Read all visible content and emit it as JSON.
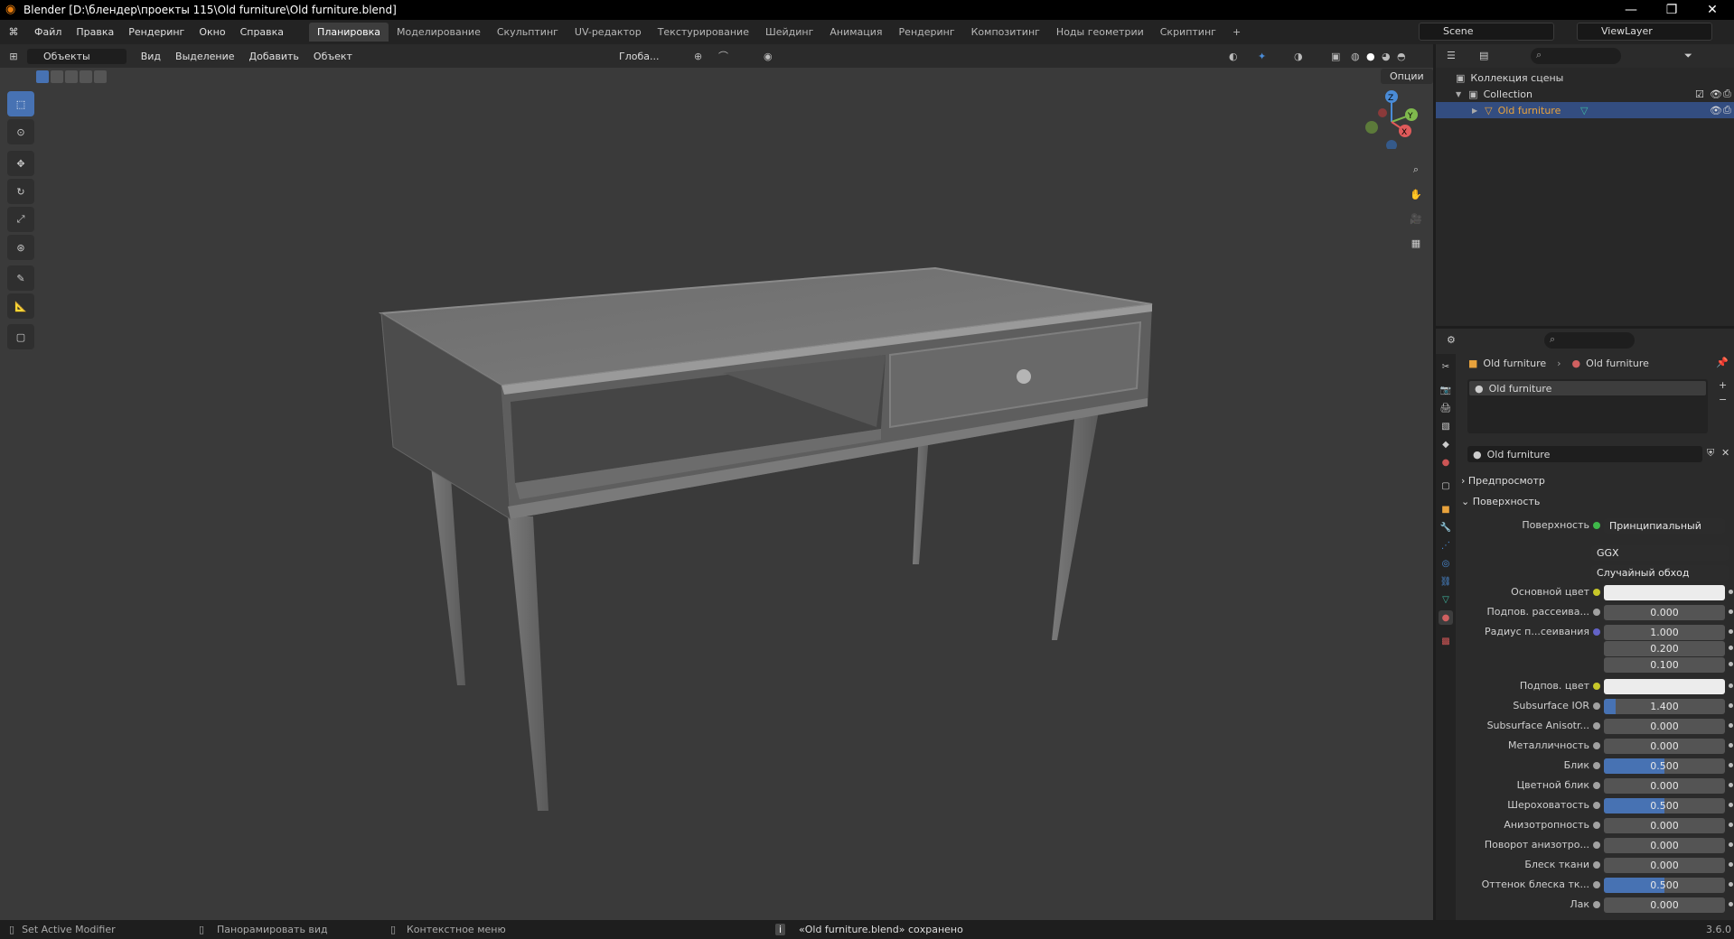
{
  "window": {
    "title": "Blender [D:\\блендер\\проекты 115\\Old furniture\\Old furniture.blend]"
  },
  "menu": [
    "Файл",
    "Правка",
    "Рендеринг",
    "Окно",
    "Справка"
  ],
  "workspaces": [
    "Планировка",
    "Моделирование",
    "Скульптинг",
    "UV-редактор",
    "Текстурирование",
    "Шейдинг",
    "Анимация",
    "Рендеринг",
    "Композитинг",
    "Ноды геометрии",
    "Скриптинг"
  ],
  "scene": {
    "name": "Scene",
    "view_layer": "ViewLayer"
  },
  "viewport_header": {
    "mode": "Объекты",
    "items": [
      "Вид",
      "Выделение",
      "Добавить",
      "Объект"
    ],
    "transform": "Глоба...",
    "options": "Опции"
  },
  "gizmo": {
    "x": "X",
    "y": "Y",
    "z": "Z"
  },
  "outliner": {
    "scene_collection": "Коллекция сцены",
    "collection": "Collection",
    "object": "Old furniture"
  },
  "props": {
    "breadcrumb_obj": "Old furniture",
    "breadcrumb_mat": "Old furniture",
    "slot": "Old furniture",
    "material_name": "Old furniture",
    "preview": "Предпросмотр",
    "surface_section": "Поверхность",
    "surface_label": "Поверхность",
    "surface_value": "Принципиальный BSDF",
    "distribution": "GGX",
    "subsurface_method": "Случайный обход",
    "fields": [
      {
        "label": "Основной цвет",
        "value": "",
        "type": "color",
        "socket": "#c7c729"
      },
      {
        "label": "Подпов. рассеива...",
        "value": "0.000",
        "fill": 0,
        "socket": "#a1a1a1"
      },
      {
        "label": "Радиус п...сеивания",
        "value": "1.000",
        "fill": 0,
        "socket": "#6363c7"
      },
      {
        "label": "",
        "value": "0.200",
        "fill": 0
      },
      {
        "label": "",
        "value": "0.100",
        "fill": 0
      },
      {
        "label": "Подпов. цвет",
        "value": "",
        "type": "color",
        "socket": "#c7c729"
      },
      {
        "label": "Subsurface IOR",
        "value": "1.400",
        "fill": 0.1,
        "socket": "#a1a1a1"
      },
      {
        "label": "Subsurface Anisotr...",
        "value": "0.000",
        "fill": 0,
        "socket": "#a1a1a1"
      },
      {
        "label": "Металличность",
        "value": "0.000",
        "fill": 0,
        "socket": "#a1a1a1"
      },
      {
        "label": "Блик",
        "value": "0.500",
        "fill": 0.5,
        "socket": "#a1a1a1"
      },
      {
        "label": "Цветной блик",
        "value": "0.000",
        "fill": 0,
        "socket": "#a1a1a1"
      },
      {
        "label": "Шероховатость",
        "value": "0.500",
        "fill": 0.5,
        "socket": "#a1a1a1"
      },
      {
        "label": "Анизотропность",
        "value": "0.000",
        "fill": 0,
        "socket": "#a1a1a1"
      },
      {
        "label": "Поворот анизотро...",
        "value": "0.000",
        "fill": 0,
        "socket": "#a1a1a1"
      },
      {
        "label": "Блеск ткани",
        "value": "0.000",
        "fill": 0,
        "socket": "#a1a1a1"
      },
      {
        "label": "Оттенок блеска тк...",
        "value": "0.500",
        "fill": 0.5,
        "socket": "#a1a1a1"
      },
      {
        "label": "Лак",
        "value": "0.000",
        "fill": 0,
        "socket": "#a1a1a1"
      }
    ]
  },
  "status": {
    "left": "Set Active Modifier",
    "pan": "Панорамировать вид",
    "context": "Контекстное меню",
    "saved": "«Old furniture.blend» сохранено",
    "version": "3.6.0"
  },
  "colors": {
    "accent": "#4772b3",
    "selected_object": "#e8a23c",
    "bg": "#3a3a3a"
  }
}
